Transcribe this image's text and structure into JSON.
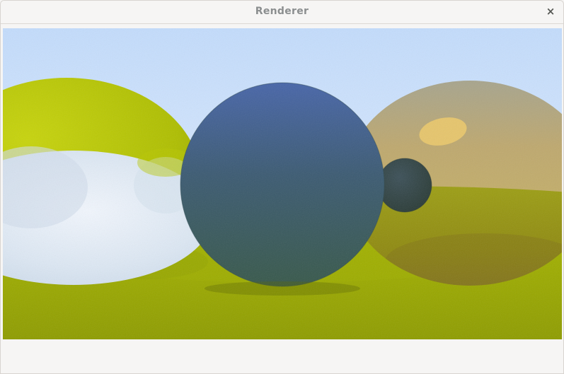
{
  "window": {
    "title": "Renderer",
    "close_glyph": "×"
  },
  "render": {
    "sky_top": "#c1dcfd",
    "sky_horizon": "#e6f0ff",
    "ground": "#a6b800",
    "center_sphere": "#3e5a7a",
    "left_sphere": "#b8c900",
    "glass_sphere": "#dfe9f4",
    "metal_sphere": "#b8a060",
    "small_sphere": "#34474e"
  }
}
